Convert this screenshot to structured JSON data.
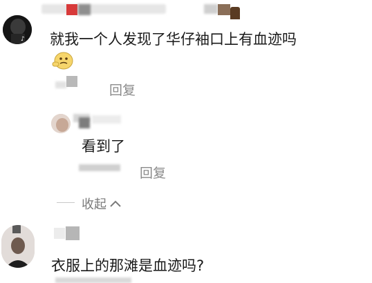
{
  "comments": [
    {
      "text": "就我一个人发现了华仔袖口上有血迹吗",
      "reply_label": "回复",
      "replies": [
        {
          "text": "看到了",
          "reply_label": "回复"
        }
      ],
      "collapse_label": "收起"
    },
    {
      "text": "衣服上的那滩是血迹吗?"
    }
  ],
  "icons": {
    "emoji": "thinking-face-emoji",
    "collapse": "chevron-up-icon"
  }
}
